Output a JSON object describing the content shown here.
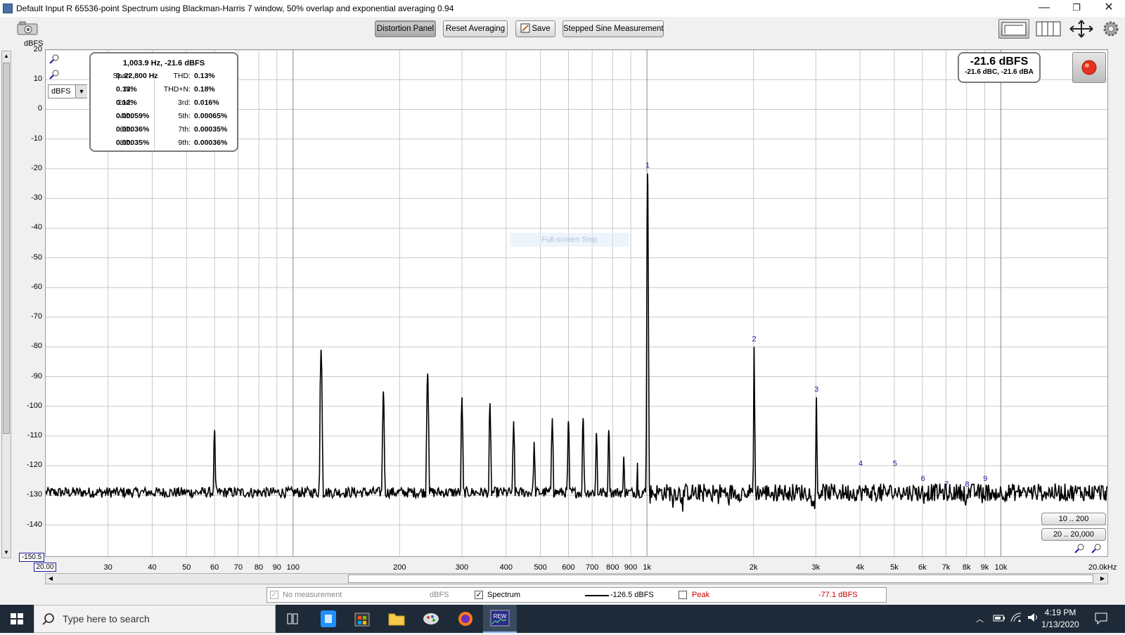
{
  "window": {
    "title": "Default Input R 65536-point Spectrum using Blackman-Harris 7 window, 50% overlap and exponential averaging 0.94",
    "minimize": "—",
    "restore": "❐",
    "close": "✕"
  },
  "toolbar": {
    "distortion_panel": "Distortion Panel",
    "reset_averaging": "Reset Averaging",
    "save": "Save",
    "stepped_sine": "Stepped Sine Measurement"
  },
  "units_select": "dBFS",
  "y_unit_label": "dBFS",
  "x_unit_label": "20.0kHz",
  "x_start_label": "20.00",
  "y_bottom_label": "-150.5",
  "distortion": {
    "header": "1,003.9 Hz, -21.6 dBFS",
    "rows": [
      {
        "l1": "Span:",
        "v1": "0..22,800 Hz",
        "l2": "THD:",
        "v2": "0.13%"
      },
      {
        "l1": "N:",
        "v1": "0.13%",
        "l2": "THD+N:",
        "v2": "0.18%"
      },
      {
        "l1": "2nd:",
        "v1": "0.12%",
        "l2": "3rd:",
        "v2": "0.016%"
      },
      {
        "l1": "4th:",
        "v1": "0.00059%",
        "l2": "5th:",
        "v2": "0.00065%"
      },
      {
        "l1": "6th:",
        "v1": "0.00036%",
        "l2": "7th:",
        "v2": "0.00035%"
      },
      {
        "l1": "8th:",
        "v1": "0.00035%",
        "l2": "9th:",
        "v2": "0.00036%"
      }
    ]
  },
  "level": {
    "main": "-21.6 dBFS",
    "sub": "-21.6 dBC, -21.6 dBA"
  },
  "range_buttons": [
    "10 .. 200",
    "20 .. 20,000"
  ],
  "watermark": "Full-screen Snip",
  "legend": {
    "no_measurement": "No measurement",
    "no_measurement_unit": "dBFS",
    "spectrum": "Spectrum",
    "spectrum_value": "-126.5 dBFS",
    "peak": "Peak",
    "peak_value": "-77.1 dBFS"
  },
  "taskbar": {
    "search_placeholder": "Type here to search",
    "time": "4:19 PM",
    "date": "1/13/2020"
  },
  "colors": {
    "trace": "#000000",
    "harmonic_label": "#1a1aa0",
    "peak_text": "#cc0000",
    "record": "#e8321e",
    "grid": "#c8c8c8"
  },
  "chart_data": {
    "type": "line",
    "title": "Default Input R 65536-point Spectrum using Blackman-Harris 7 window, 50% overlap and exponential averaging 0.94",
    "xlabel": "",
    "ylabel": "dBFS",
    "x_scale": "log",
    "xlim": [
      20,
      20000
    ],
    "ylim": [
      -150.5,
      20
    ],
    "y_ticks": [
      20,
      10,
      0,
      -10,
      -20,
      -30,
      -40,
      -50,
      -60,
      -70,
      -80,
      -90,
      -100,
      -110,
      -120,
      -130,
      -140
    ],
    "x_ticks": [
      {
        "v": 30,
        "l": "30"
      },
      {
        "v": 40,
        "l": "40"
      },
      {
        "v": 50,
        "l": "50"
      },
      {
        "v": 60,
        "l": "60"
      },
      {
        "v": 70,
        "l": "70"
      },
      {
        "v": 80,
        "l": "80"
      },
      {
        "v": 90,
        "l": "90"
      },
      {
        "v": 100,
        "l": "100"
      },
      {
        "v": 200,
        "l": "200"
      },
      {
        "v": 300,
        "l": "300"
      },
      {
        "v": 400,
        "l": "400"
      },
      {
        "v": 500,
        "l": "500"
      },
      {
        "v": 600,
        "l": "600"
      },
      {
        "v": 700,
        "l": "700"
      },
      {
        "v": 800,
        "l": "800"
      },
      {
        "v": 900,
        "l": "900"
      },
      {
        "v": 1000,
        "l": "1k"
      },
      {
        "v": 2000,
        "l": "2k"
      },
      {
        "v": 3000,
        "l": "3k"
      },
      {
        "v": 4000,
        "l": "4k"
      },
      {
        "v": 5000,
        "l": "5k"
      },
      {
        "v": 6000,
        "l": "6k"
      },
      {
        "v": 7000,
        "l": "7k"
      },
      {
        "v": 8000,
        "l": "8k"
      },
      {
        "v": 9000,
        "l": "9k"
      },
      {
        "v": 10000,
        "l": "10k"
      }
    ],
    "grid": true,
    "noise_floor_db": -129,
    "peaks": [
      {
        "f": 60,
        "db": -108
      },
      {
        "f": 120,
        "db": -81
      },
      {
        "f": 180,
        "db": -95
      },
      {
        "f": 240,
        "db": -89
      },
      {
        "f": 300,
        "db": -97
      },
      {
        "f": 360,
        "db": -99
      },
      {
        "f": 420,
        "db": -105
      },
      {
        "f": 480,
        "db": -112
      },
      {
        "f": 540,
        "db": -104
      },
      {
        "f": 600,
        "db": -105
      },
      {
        "f": 660,
        "db": -104
      },
      {
        "f": 720,
        "db": -109
      },
      {
        "f": 780,
        "db": -108
      },
      {
        "f": 860,
        "db": -117
      },
      {
        "f": 940,
        "db": -119
      },
      {
        "f": 1003.9,
        "db": -21.6
      },
      {
        "f": 2007.8,
        "db": -80
      },
      {
        "f": 3011.7,
        "db": -97
      }
    ],
    "harmonic_labels": [
      {
        "n": "1",
        "f": 1003.9,
        "db": -21.6
      },
      {
        "n": "2",
        "f": 2007.8,
        "db": -80
      },
      {
        "n": "3",
        "f": 3011.7,
        "db": -97
      },
      {
        "n": "4",
        "f": 4015.6,
        "db": -122
      },
      {
        "n": "5",
        "f": 5019.5,
        "db": -122
      },
      {
        "n": "6",
        "f": 6023.4,
        "db": -127
      },
      {
        "n": "7",
        "f": 7027.3,
        "db": -129
      },
      {
        "n": "8",
        "f": 8031.2,
        "db": -129
      },
      {
        "n": "9",
        "f": 9035.1,
        "db": -127
      }
    ]
  }
}
